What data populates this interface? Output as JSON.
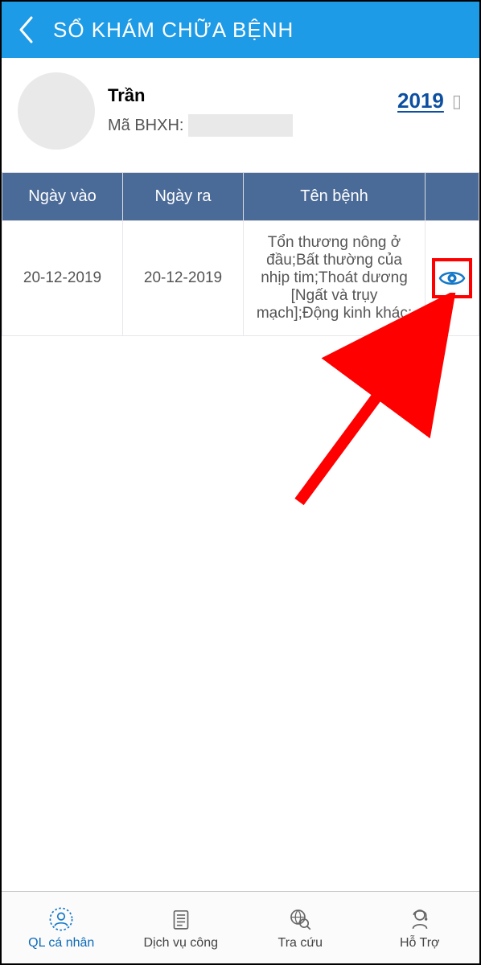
{
  "header": {
    "title": "SỔ KHÁM CHỮA BỆNH"
  },
  "profile": {
    "name_prefix": "Trần",
    "code_label": "Mã BHXH:",
    "year": "2019"
  },
  "table": {
    "headers": {
      "in": "Ngày vào",
      "out": "Ngày ra",
      "name": "Tên bệnh"
    },
    "rows": [
      {
        "in": "20-12-2019",
        "out": "20-12-2019",
        "name": "Tổn thương nông ở đầu;Bất thường của nhịp tim;Thoát dương [Ngất và trụy mạch];Động kinh khác;"
      }
    ]
  },
  "nav": {
    "personal": "QL cá nhân",
    "services": "Dịch vụ công",
    "lookup": "Tra cứu",
    "support": "Hỗ Trợ"
  }
}
